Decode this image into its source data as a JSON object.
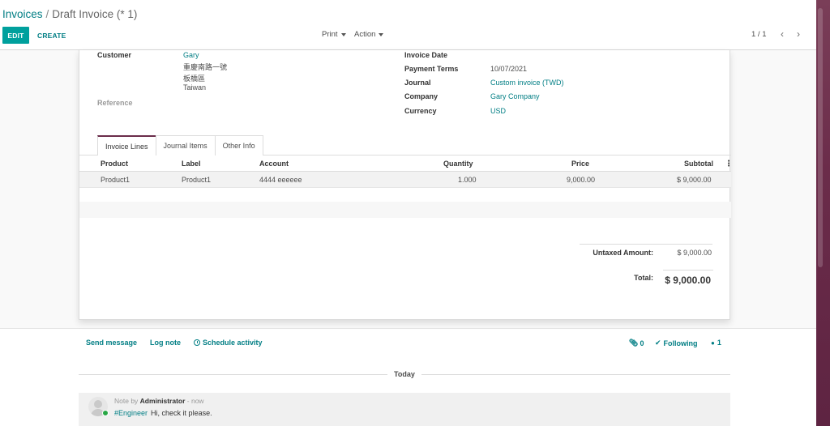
{
  "breadcrumb": {
    "parent": "Invoices",
    "separator": "/",
    "current": "Draft Invoice (* 1)"
  },
  "toolbar": {
    "edit_label": "EDIT",
    "create_label": "CREATE",
    "print_label": "Print",
    "action_label": "Action"
  },
  "pager": {
    "value": "1 / 1",
    "prev_icon": "chevron-left",
    "next_icon": "chevron-right"
  },
  "form": {
    "customer_label": "Customer",
    "customer_name": "Gary",
    "customer_address": [
      "重慶南路一號",
      "板橋區",
      "Taiwan"
    ],
    "reference_label": "Reference",
    "invoice_date_label": "Invoice Date",
    "payment_terms_label": "Payment Terms",
    "payment_terms_value": "10/07/2021",
    "journal_label": "Journal",
    "journal_value": "Custom invoice (TWD)",
    "company_label": "Company",
    "company_value": "Gary Company",
    "currency_label": "Currency",
    "currency_value": "USD"
  },
  "tabs": [
    "Invoice Lines",
    "Journal Items",
    "Other Info"
  ],
  "lines": {
    "columns": [
      "Product",
      "Label",
      "Account",
      "Quantity",
      "Price",
      "Subtotal"
    ],
    "rows": [
      {
        "product": "Product1",
        "label": "Product1",
        "account": "4444 eeeeee",
        "quantity": "1.000",
        "price": "9,000.00",
        "subtotal": "$ 9,000.00"
      }
    ]
  },
  "totals": {
    "untaxed_label": "Untaxed Amount:",
    "untaxed_value": "$ 9,000.00",
    "total_label": "Total:",
    "total_value": "$ 9,000.00"
  },
  "chatter": {
    "send_message": "Send message",
    "log_note": "Log note",
    "schedule_activity": "Schedule activity",
    "attachments_count": "0",
    "following_label": "Following",
    "followers_count": "1",
    "date_separator": "Today",
    "message": {
      "type": "Note by",
      "author": "Administrator",
      "time": "- now",
      "tag": "#Engineer",
      "text": "Hi, check it please."
    }
  },
  "colors": {
    "brand": "#00a09d",
    "link": "#017e84",
    "tab_accent": "#6b2c4a",
    "online": "#28a745"
  }
}
